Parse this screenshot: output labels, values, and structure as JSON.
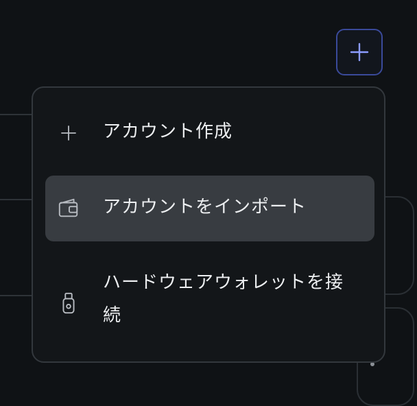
{
  "add_button": {
    "icon": "plus-icon",
    "color": "#8c9cff",
    "border_color": "#3a4a9a"
  },
  "menu": {
    "items": [
      {
        "label": "アカウント作成",
        "icon": "plus-icon"
      },
      {
        "label": "アカウントをインポート",
        "icon": "wallet-icon",
        "selected": true
      },
      {
        "label": "ハードウェアウォレットを接続",
        "icon": "usb-key-icon"
      }
    ]
  },
  "colors": {
    "background": "#0f1215",
    "menu_bg": "#131619",
    "hover_bg": "#383c41",
    "text": "#eceef0"
  }
}
